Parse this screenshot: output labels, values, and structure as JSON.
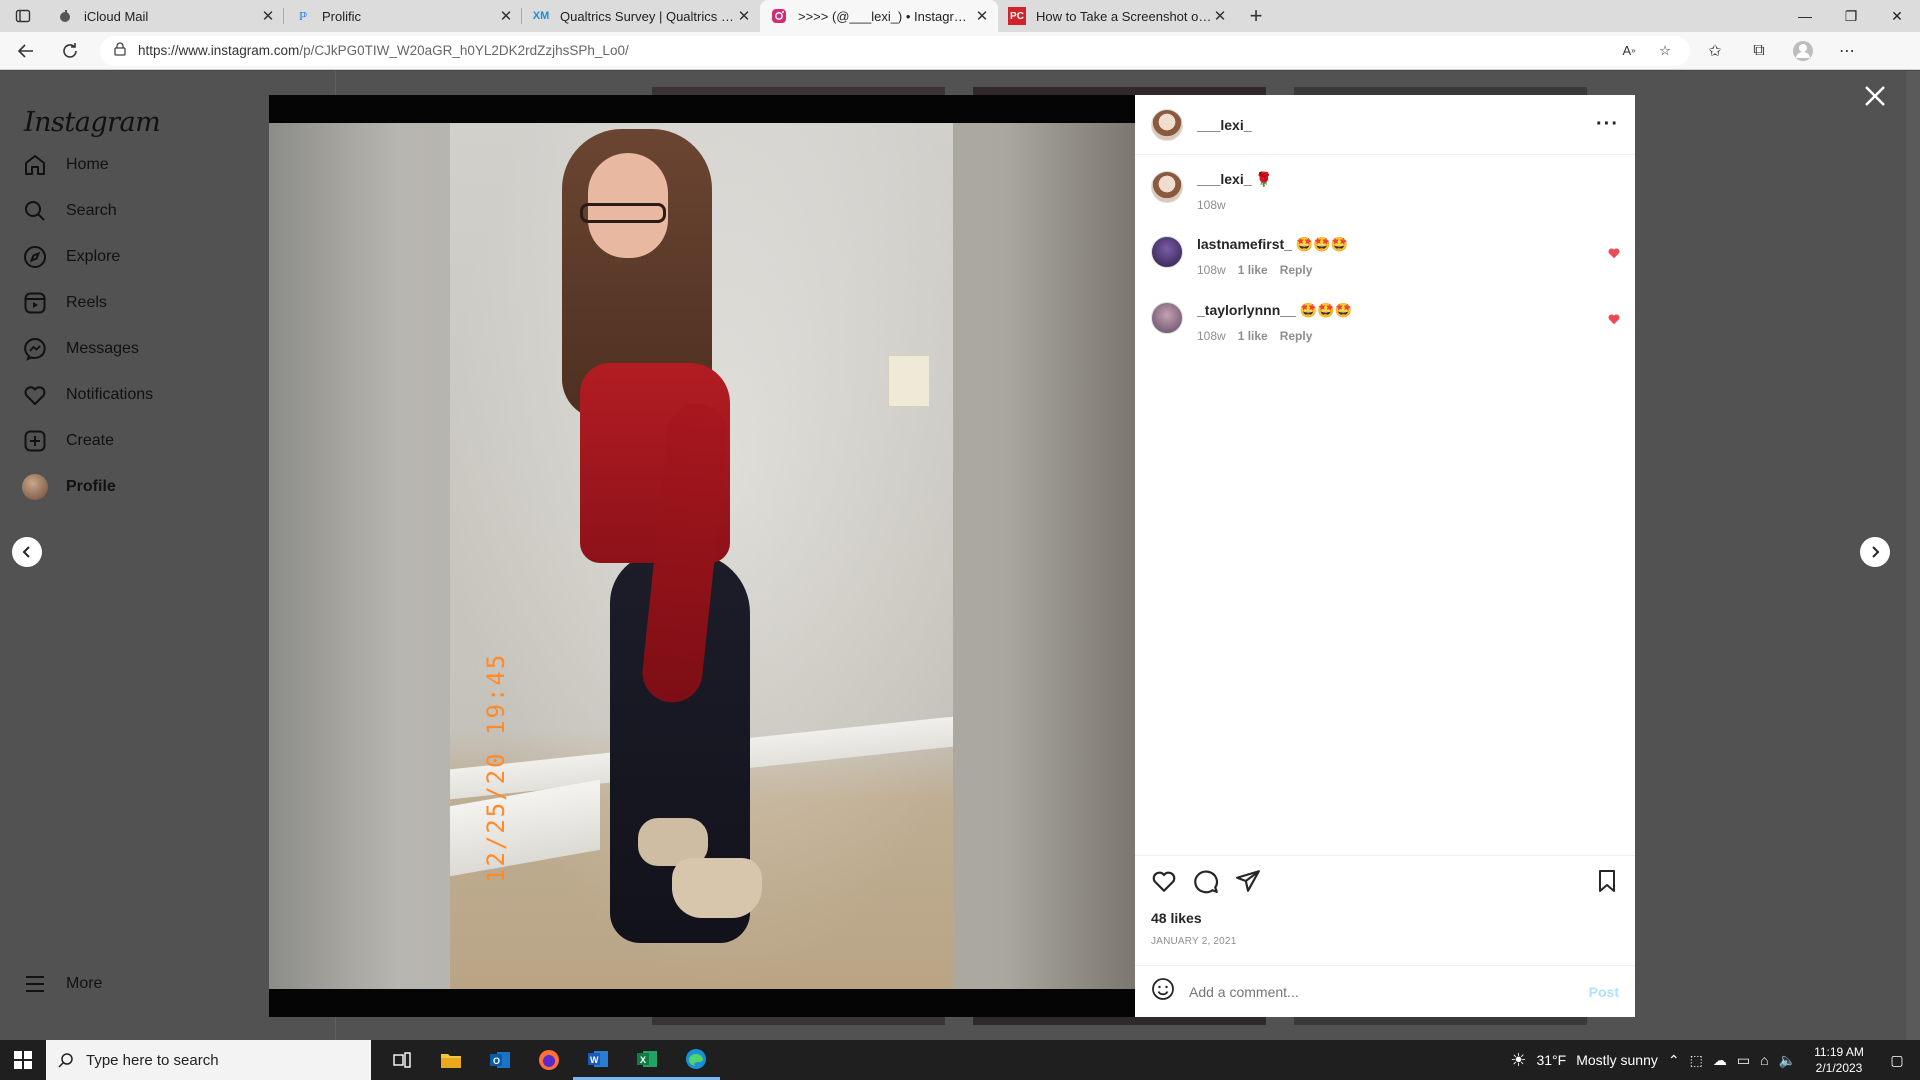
{
  "browser": {
    "tabs": [
      {
        "title": "iCloud Mail",
        "icon": "apple-icon"
      },
      {
        "title": "Prolific",
        "icon": "prolific-icon"
      },
      {
        "title": "Qualtrics Survey | Qualtrics Exper",
        "icon": "qualtrics-icon"
      },
      {
        "title": ">>>> (@___lexi_) • Instagram p",
        "icon": "instagram-icon",
        "active": true
      },
      {
        "title": "How to Take a Screenshot on An",
        "icon": "pcmag-icon"
      }
    ],
    "url_host": "https://www.instagram.com",
    "url_path": "/p/CJkPG0TIW_W20aGR_h0YL2DK2rdZzjhsSPh_Lo0/"
  },
  "sidebar": {
    "logo": "Instagram",
    "items": [
      {
        "label": "Home",
        "icon": "home-icon"
      },
      {
        "label": "Search",
        "icon": "search-icon"
      },
      {
        "label": "Explore",
        "icon": "compass-icon"
      },
      {
        "label": "Reels",
        "icon": "reels-icon"
      },
      {
        "label": "Messages",
        "icon": "messenger-icon"
      },
      {
        "label": "Notifications",
        "icon": "heart-icon"
      },
      {
        "label": "Create",
        "icon": "plus-square-icon"
      },
      {
        "label": "Profile",
        "icon": "avatar"
      }
    ],
    "more_label": "More"
  },
  "photo": {
    "datestamp": "12/25/20 19:45"
  },
  "post": {
    "author": "___lexi_",
    "caption_user": "___lexi_",
    "caption_emoji": "🌹",
    "caption_time": "108w",
    "comments": [
      {
        "user": "lastnamefirst_",
        "text": "🤩🤩🤩",
        "time": "108w",
        "likes": "1 like",
        "reply": "Reply"
      },
      {
        "user": "_taylorlynnn__",
        "text": "🤩🤩🤩",
        "time": "108w",
        "likes": "1 like",
        "reply": "Reply"
      }
    ],
    "likes": "48 likes",
    "date": "JANUARY 2, 2021",
    "add_comment_placeholder": "Add a comment...",
    "post_label": "Post"
  },
  "taskbar": {
    "search_placeholder": "Type here to search",
    "weather_temp": "31°F",
    "weather_text": "Mostly sunny",
    "time": "11:19 AM",
    "date": "2/1/2023"
  },
  "colors": {
    "accent_like": "#ed4956",
    "post_button": "#b2dffc",
    "overlay": "#525252"
  }
}
